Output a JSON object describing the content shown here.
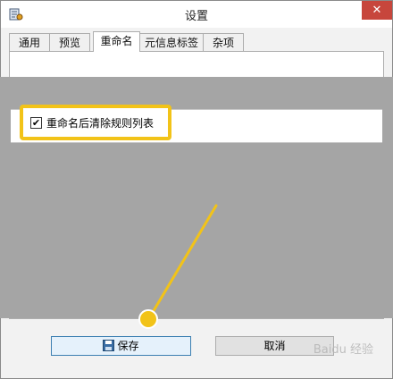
{
  "window": {
    "title": "设置",
    "close_symbol": "✕"
  },
  "tabs": [
    {
      "label": "通用",
      "active": false
    },
    {
      "label": "预览",
      "active": false
    },
    {
      "label": "重命名",
      "active": true
    },
    {
      "label": "元信息标签",
      "active": false
    },
    {
      "label": "杂项",
      "active": false
    }
  ],
  "options": {
    "clear_rules_label": "重命名后清除规则列表",
    "clear_rules_checked": true,
    "check_mark": "✔"
  },
  "buttons": {
    "save_label": "保存",
    "cancel_label": "取消"
  },
  "watermark": {
    "text": "Baidu 经验"
  },
  "icons": {
    "app": "app-settings-icon",
    "save": "floppy-disk-icon",
    "close": "close-icon"
  },
  "colors": {
    "highlight": "#f2c318",
    "close_button": "#c7463c",
    "overlay": "#a5a5a5"
  }
}
